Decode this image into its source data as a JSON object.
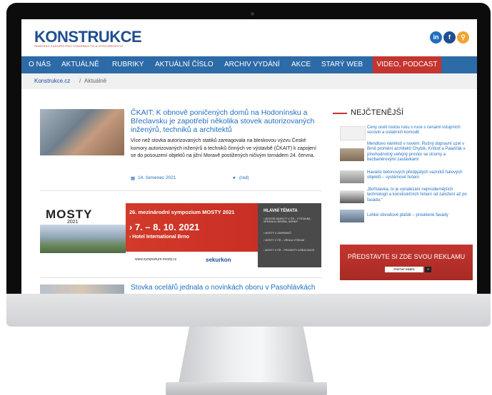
{
  "site": {
    "logo": "KONSTRUKCE",
    "tagline": "ODBORNÝ ČASOPIS PRO STAVEBNICTVÍ A STROJÍRENSTVÍ"
  },
  "social": {
    "linkedin": "in",
    "facebook": "f",
    "search": "⚲"
  },
  "nav": [
    "O NÁS",
    "AKTUÁLNĚ",
    "RUBRIKY",
    "AKTUÁLNÍ ČÍSLO",
    "ARCHIV VYDÁNÍ",
    "AKCE",
    "STARÝ WEB",
    "VIDEO, PODCAST"
  ],
  "breadcrumb": {
    "home": "Konstrukce.cz",
    "separator": "/",
    "current": "Aktuálně"
  },
  "article": {
    "title": "ČKAIT: K obnově poničených domů na Hodonínsku a Břeclavsku je zapotřebí několika stovek autorizovaných inženýrů, techniků a architektů",
    "text": "Více než stovka autorizovaných statiků zareagovala na bleskovou výzvu České komory autorizovaných inženýrů a techniků činných ve výstavbě (ČKAIT) k zapojení se do posouzení objektů na jižní Moravě postižených ničivým tornádem 24. června.",
    "date": "14. červenec 2021",
    "author": "(red)"
  },
  "banner": {
    "name": "MOSTY",
    "year": "2021",
    "symposium": "26. mezinárodní sympozium MOSTY 2021",
    "dates": "› 7. – 8. 10. 2021",
    "venue": "› Hotel International Brno",
    "url": "www.sympozium-mosty.cz",
    "sponsor": "sekurkon",
    "topics_title": "HLAVNÍ TÉMATA",
    "topics": [
      "› MOSTNÍ OBJEKTY V ČR – VÝSTAVBA, SPRÁVA A ÚDRŽBA, NORMY",
      "› MOSTY V ZAHRANIČÍ",
      "› MOSTY V ČR – VĚDA A VÝZKUM",
      "› MOSTY V ČR – PROJEKTY A REALIZACE"
    ]
  },
  "article2": {
    "title": "Stovka ocelářů jednala o novinkách oboru v Pasohlávkách"
  },
  "sidebar": {
    "title": "NEJČTENĚJŠÍ",
    "items": [
      "Ceny oceli rostou ruku v ruce s cenami vstupních surovin a ostatních komodit",
      "Mendlovo náměstí v novém: Rušný dopravní uzel v Brně promění architekti Chybík, Krištof a Palašťák v plnohodnotný veřejný prostor se stromy a bezbariérovými zastávkami",
      "Havárie betonových předpjatých vazníků halových objektů – systémové řešení",
      "„Bořislavka, to je vynalézání nejmodernějších technologií a konstrukčních řešení od založení až po fasádu,“",
      "Lehké obvodové pláště – prosklené fasády"
    ],
    "ad_text": "PŘEDSTAVTE SI ZDE SVOU REKLAMU",
    "ad_button": "POPTAT IHNED",
    "ad_arrow": "»"
  },
  "colors": {
    "nav": "#2c6aa8",
    "accent": "#c4352f",
    "link": "#1f6fc0",
    "logo": "#1f4e91"
  }
}
